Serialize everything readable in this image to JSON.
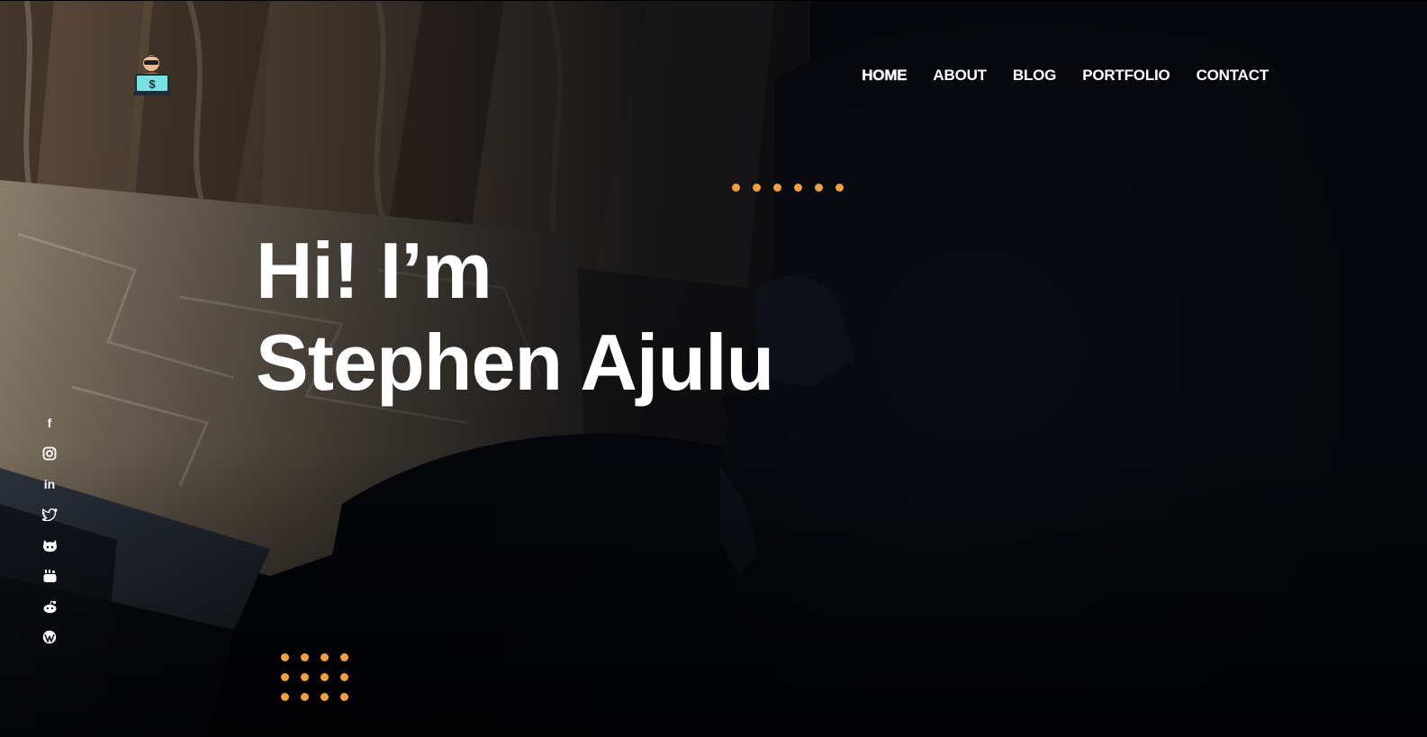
{
  "nav": {
    "items": [
      {
        "label": "HOME",
        "active": true
      },
      {
        "label": "ABOUT"
      },
      {
        "label": "BLOG"
      },
      {
        "label": "PORTFOLIO"
      },
      {
        "label": "CONTACT"
      }
    ]
  },
  "hero": {
    "greeting": "Hi! I’m",
    "name": "Stephen Ajulu"
  },
  "social": {
    "items": [
      {
        "icon": "facebook-icon",
        "glyph": "f"
      },
      {
        "icon": "instagram-icon"
      },
      {
        "icon": "linkedin-icon",
        "glyph": "in"
      },
      {
        "icon": "twitter-icon"
      },
      {
        "icon": "github-icon"
      },
      {
        "icon": "youtube-icon"
      },
      {
        "icon": "reddit-icon"
      },
      {
        "icon": "wordpress-icon"
      }
    ]
  },
  "colors": {
    "accent": "#f2a03a",
    "text": "#ffffff",
    "background": "#05070c"
  }
}
